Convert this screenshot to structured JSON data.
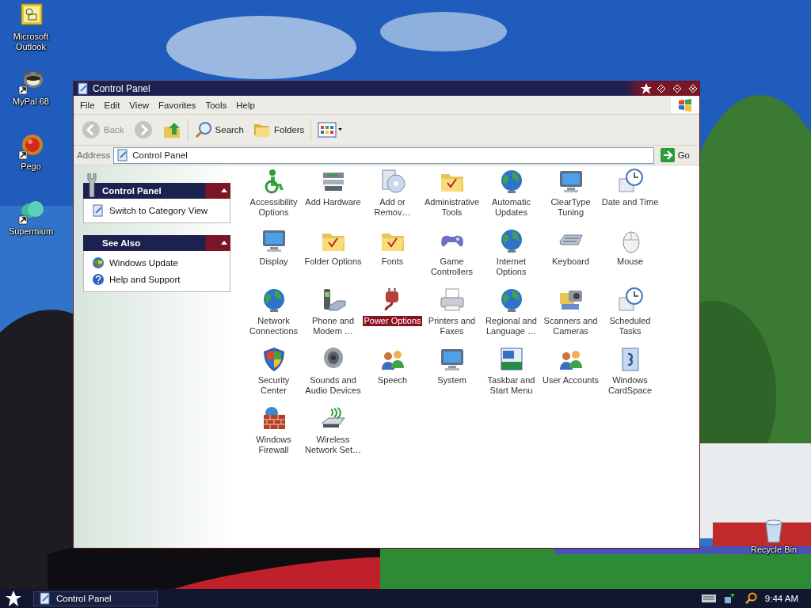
{
  "desktop_icons": [
    {
      "kind": "mail",
      "label": "Microsoft Outlook",
      "shortcut": false
    },
    {
      "kind": "animal",
      "label": "MyPal 68",
      "shortcut": true
    },
    {
      "kind": "ball",
      "label": "Pego",
      "shortcut": true
    },
    {
      "kind": "cloud",
      "label": "Supermium",
      "shortcut": true
    }
  ],
  "recycle_bin": {
    "label": "Recycle Bin"
  },
  "window": {
    "title": "Control Panel",
    "menu": [
      "File",
      "Edit",
      "View",
      "Favorites",
      "Tools",
      "Help"
    ],
    "toolbar": {
      "back": {
        "label": "Back",
        "disabled": true
      },
      "forward": {
        "disabled": true
      },
      "search": "Search",
      "folders": "Folders"
    },
    "address": {
      "label": "Address",
      "value": "Control Panel",
      "go": "Go"
    },
    "sidebar": [
      {
        "kind": "tasks",
        "title": "Control Panel",
        "expanded": true,
        "items": [
          {
            "kind": "category",
            "label": "Switch to Category View"
          }
        ]
      },
      {
        "kind": "links",
        "title": "See Also",
        "expanded": true,
        "items": [
          {
            "kind": "update",
            "label": "Windows Update"
          },
          {
            "kind": "help",
            "label": "Help and Support"
          }
        ]
      }
    ],
    "items": [
      {
        "kind": "accessibility",
        "label": "Accessibility Options",
        "selected": false
      },
      {
        "kind": "hardware",
        "label": "Add Hardware",
        "selected": false
      },
      {
        "kind": "disc",
        "label": "Add or Remov…",
        "selected": false
      },
      {
        "kind": "folder",
        "label": "Administrative Tools",
        "selected": false
      },
      {
        "kind": "globe",
        "label": "Automatic Updates",
        "selected": false
      },
      {
        "kind": "monitor",
        "label": "ClearType Tuning",
        "selected": false
      },
      {
        "kind": "clock",
        "label": "Date and Time",
        "selected": false
      },
      {
        "kind": "monitor",
        "label": "Display",
        "selected": false
      },
      {
        "kind": "folder",
        "label": "Folder Options",
        "selected": false
      },
      {
        "kind": "folder",
        "label": "Fonts",
        "selected": false
      },
      {
        "kind": "gamepad",
        "label": "Game Controllers",
        "selected": false
      },
      {
        "kind": "globe",
        "label": "Internet Options",
        "selected": false
      },
      {
        "kind": "keyboard",
        "label": "Keyboard",
        "selected": false
      },
      {
        "kind": "mouse",
        "label": "Mouse",
        "selected": false
      },
      {
        "kind": "globe",
        "label": "Network Connections",
        "selected": false
      },
      {
        "kind": "phone",
        "label": "Phone and Modem …",
        "selected": false
      },
      {
        "kind": "plug",
        "label": "Power Options",
        "selected": true
      },
      {
        "kind": "printer",
        "label": "Printers and Faxes",
        "selected": false
      },
      {
        "kind": "globe",
        "label": "Regional and Language …",
        "selected": false
      },
      {
        "kind": "camera",
        "label": "Scanners and Cameras",
        "selected": false
      },
      {
        "kind": "clock",
        "label": "Scheduled Tasks",
        "selected": false
      },
      {
        "kind": "shield",
        "label": "Security Center",
        "selected": false
      },
      {
        "kind": "speaker",
        "label": "Sounds and Audio Devices",
        "selected": false
      },
      {
        "kind": "people",
        "label": "Speech",
        "selected": false
      },
      {
        "kind": "monitor",
        "label": "System",
        "selected": false
      },
      {
        "kind": "window",
        "label": "Taskbar and Start Menu",
        "selected": false
      },
      {
        "kind": "people",
        "label": "User Accounts",
        "selected": false
      },
      {
        "kind": "card",
        "label": "Windows CardSpace",
        "selected": false
      },
      {
        "kind": "wall",
        "label": "Windows Firewall",
        "selected": false
      },
      {
        "kind": "wireless",
        "label": "Wireless Network Set…",
        "selected": false
      }
    ]
  },
  "taskbar": {
    "tasks": [
      {
        "label": "Control Panel",
        "selected": false
      }
    ],
    "clock": "9:44 AM"
  }
}
